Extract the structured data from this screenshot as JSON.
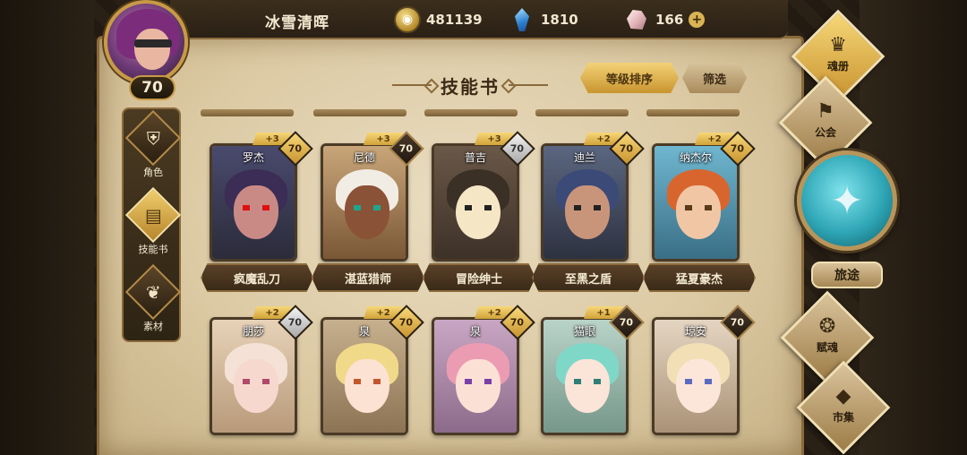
{
  "player": {
    "name": "冰雪清晖",
    "level": "70"
  },
  "resources": {
    "gold": "481139",
    "gems": "1810",
    "crystals": "166",
    "add": "+"
  },
  "left_nav": [
    {
      "label": "角色",
      "icon": "helmet-icon"
    },
    {
      "label": "技能书",
      "icon": "skillbook-icon"
    },
    {
      "label": "素材",
      "icon": "materials-icon"
    }
  ],
  "page": {
    "title": "技能书",
    "sort_label": "等级排序",
    "filter_label": "筛选"
  },
  "cards": [
    {
      "hero": "罗杰",
      "skill": "疯魔乱刀",
      "plus": "+3",
      "level": "70",
      "badge": "gold"
    },
    {
      "hero": "尼德",
      "skill": "湛蓝猎师",
      "plus": "+3",
      "level": "70",
      "badge": "dark"
    },
    {
      "hero": "普吉",
      "skill": "冒险绅士",
      "plus": "+3",
      "level": "70",
      "badge": "silver"
    },
    {
      "hero": "迪兰",
      "skill": "至黑之盾",
      "plus": "+2",
      "level": "70",
      "badge": "gold"
    },
    {
      "hero": "纳杰尔",
      "skill": "猛夏豪杰",
      "plus": "+2",
      "level": "70",
      "badge": "gold"
    },
    {
      "hero": "朋莎",
      "skill": "",
      "plus": "+2",
      "level": "70",
      "badge": "silver"
    },
    {
      "hero": "泉",
      "skill": "",
      "plus": "+2",
      "level": "70",
      "badge": "gold"
    },
    {
      "hero": "泉",
      "skill": "",
      "plus": "+2",
      "level": "70",
      "badge": "gold"
    },
    {
      "hero": "猫眼",
      "skill": "",
      "plus": "+1",
      "level": "70",
      "badge": "dark"
    },
    {
      "hero": "琼安",
      "skill": "",
      "plus": "",
      "level": "70",
      "badge": "dark"
    }
  ],
  "right_nav": [
    {
      "label": "魂册",
      "icon": "soulbook-icon"
    },
    {
      "label": "公会",
      "icon": "guild-icon"
    },
    {
      "label": "旅途",
      "icon": "journey-icon"
    },
    {
      "label": "赋魂",
      "icon": "soul-flame-icon"
    },
    {
      "label": "市集",
      "icon": "market-icon"
    }
  ],
  "colors": {
    "accent_gold": "#d9b453",
    "parchment": "#e9dcc0",
    "frame_brown": "#8b6a3b",
    "teal_medal": "#2fa6b6"
  }
}
